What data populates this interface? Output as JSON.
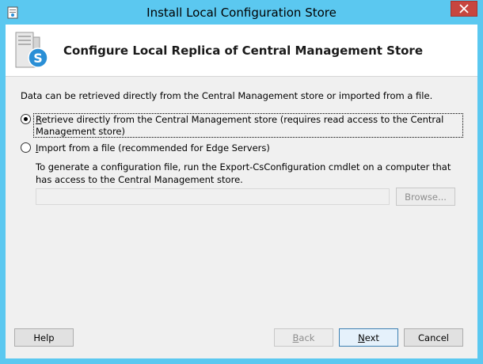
{
  "window": {
    "title": "Install Local Configuration Store",
    "close_glyph": "✕",
    "colors": {
      "titlebar": "#5bc8f0",
      "close": "#c7463f"
    }
  },
  "header": {
    "title": "Configure Local Replica of Central Management Store",
    "icon": "skype-server-icon"
  },
  "body": {
    "intro": "Data can be retrieved directly from the Central Management store or imported from a file.",
    "option_retrieve": {
      "mnemonic": "R",
      "rest": "etrieve directly from the Central Management store (requires read access to the Central Management store)",
      "selected": true
    },
    "option_import": {
      "mnemonic": "I",
      "rest": "mport from a file (recommended for Edge Servers)",
      "selected": false
    },
    "import_help": "To generate a configuration file, run the Export-CsConfiguration cmdlet on a computer that has access to the Central Management store.",
    "file_path_value": "",
    "browse_label": "Browse..."
  },
  "footer": {
    "help_label": "Help",
    "back_mnemonic": "B",
    "back_rest": "ack",
    "next_mnemonic": "N",
    "next_rest": "ext",
    "cancel_label": "Cancel"
  }
}
